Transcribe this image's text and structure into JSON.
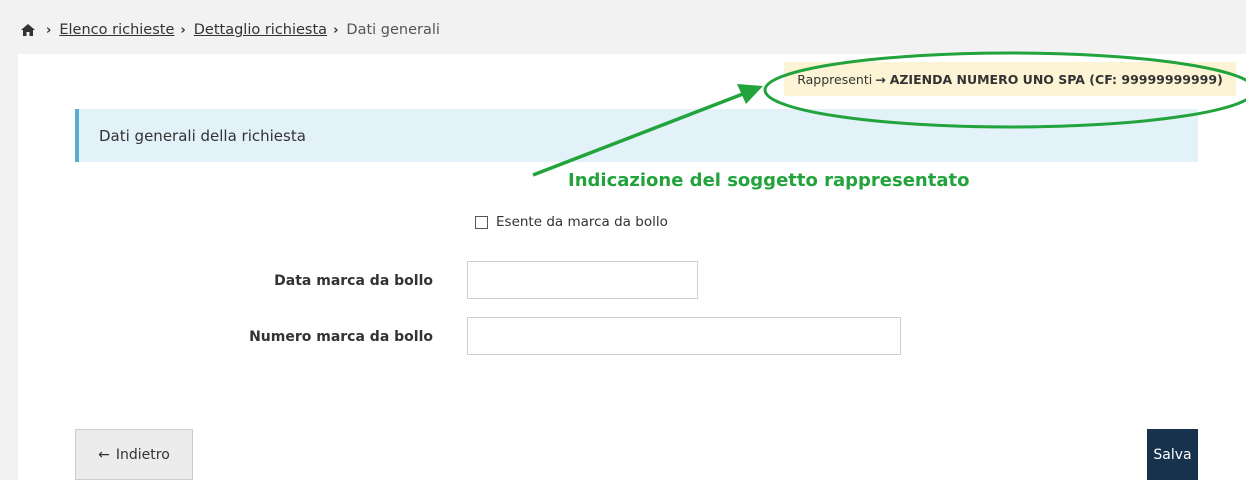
{
  "breadcrumb": {
    "items": [
      "Elenco richieste",
      "Dettaglio richiesta"
    ],
    "current": "Dati generali"
  },
  "represents": {
    "label": "Rappresenti",
    "arrow": "→",
    "entity": "AZIENDA NUMERO UNO SPA (CF: 99999999999)"
  },
  "section": {
    "title": "Dati generali della richiesta"
  },
  "annotation": {
    "text": "Indicazione del soggetto rappresentato",
    "color": "#22a33c"
  },
  "form": {
    "exempt_label": "Esente da marca da bollo",
    "exempt_checked": false,
    "date_label": "Data marca da bollo",
    "date_value": "",
    "number_label": "Numero marca da bollo",
    "number_value": ""
  },
  "buttons": {
    "back_arrow": "←",
    "back_label": "Indietro",
    "save_label": "Salva"
  },
  "colors": {
    "save_button": "#17324d",
    "section_accent": "#5aaed2",
    "badge_bg": "#fcf4d4"
  },
  "icons": {
    "home": "home-icon"
  }
}
